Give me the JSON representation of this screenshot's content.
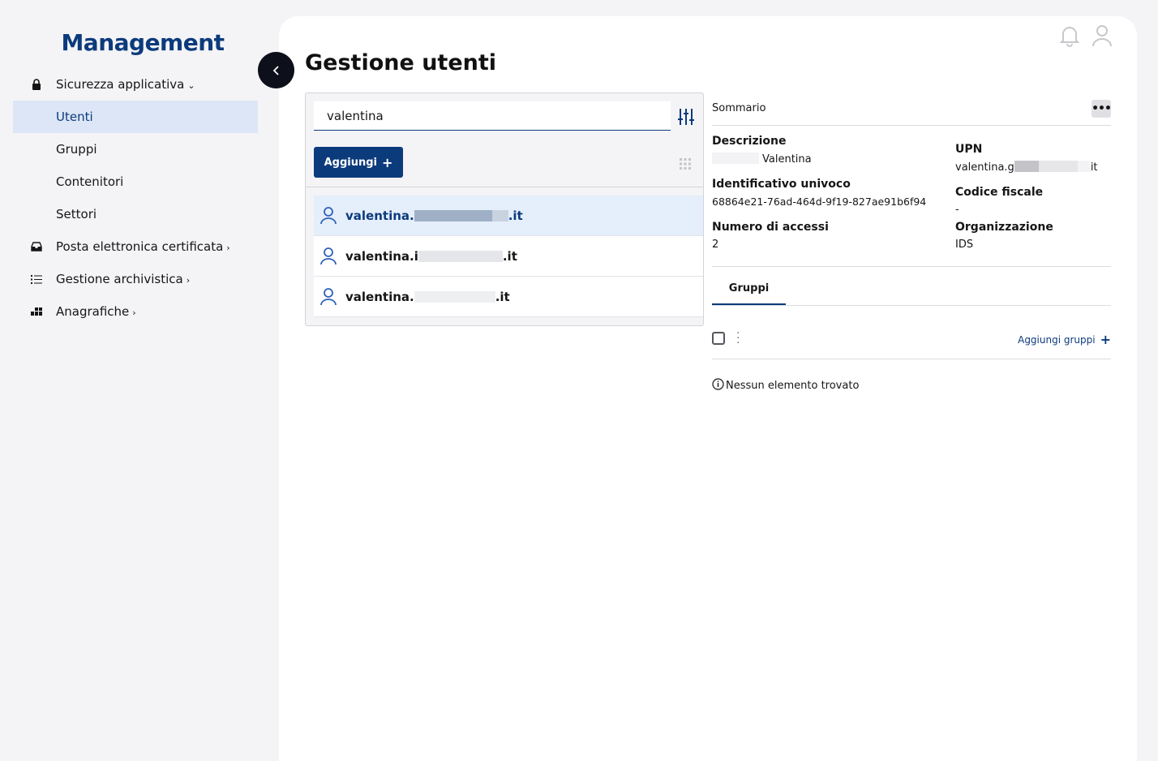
{
  "sidebar": {
    "brand": "Management",
    "items": [
      {
        "label": "Sicurezza applicativa",
        "icon": "lock-icon",
        "expanded": true
      },
      {
        "label": "Utenti",
        "active": true
      },
      {
        "label": "Gruppi"
      },
      {
        "label": "Contenitori"
      },
      {
        "label": "Settori"
      },
      {
        "label": "Posta elettronica certificata",
        "icon": "inbox-icon"
      },
      {
        "label": "Gestione archivistica",
        "icon": "list-icon"
      },
      {
        "label": "Anagrafiche",
        "icon": "grid-blocks-icon"
      }
    ]
  },
  "header": {
    "title": "Gestione utenti",
    "icons": [
      "bell-icon",
      "user-profile-icon"
    ]
  },
  "search": {
    "value": "valentina"
  },
  "toolbar": {
    "add_label": "Aggiungi"
  },
  "users": [
    {
      "prefix": "valentina.",
      "suffix": ".it",
      "selected": true
    },
    {
      "prefix": "valentina.i",
      "suffix": ".it",
      "selected": false
    },
    {
      "prefix": "valentina.",
      "suffix": ".it",
      "selected": false
    }
  ],
  "detail": {
    "summary_label": "Sommario",
    "descrizione_label": "Descrizione",
    "descrizione_value": "Valentina",
    "upn_label": "UPN",
    "upn_prefix": "valentina.g",
    "upn_suffix": "it",
    "id_label": "Identificativo univoco",
    "id_value": "68864e21-76ad-464d-9f19-827ae91b6f94",
    "cf_label": "Codice fiscale",
    "cf_value": "-",
    "accessi_label": "Numero di accessi",
    "accessi_value": "2",
    "org_label": "Organizzazione",
    "org_value": "IDS",
    "tab_label": "Gruppi",
    "add_groups_label": "Aggiungi gruppi",
    "empty_message": "Nessun elemento trovato"
  },
  "colors": {
    "accent": "#0c3b7c",
    "active_bg": "#dce6f7",
    "selected_row": "#e5eefb"
  }
}
